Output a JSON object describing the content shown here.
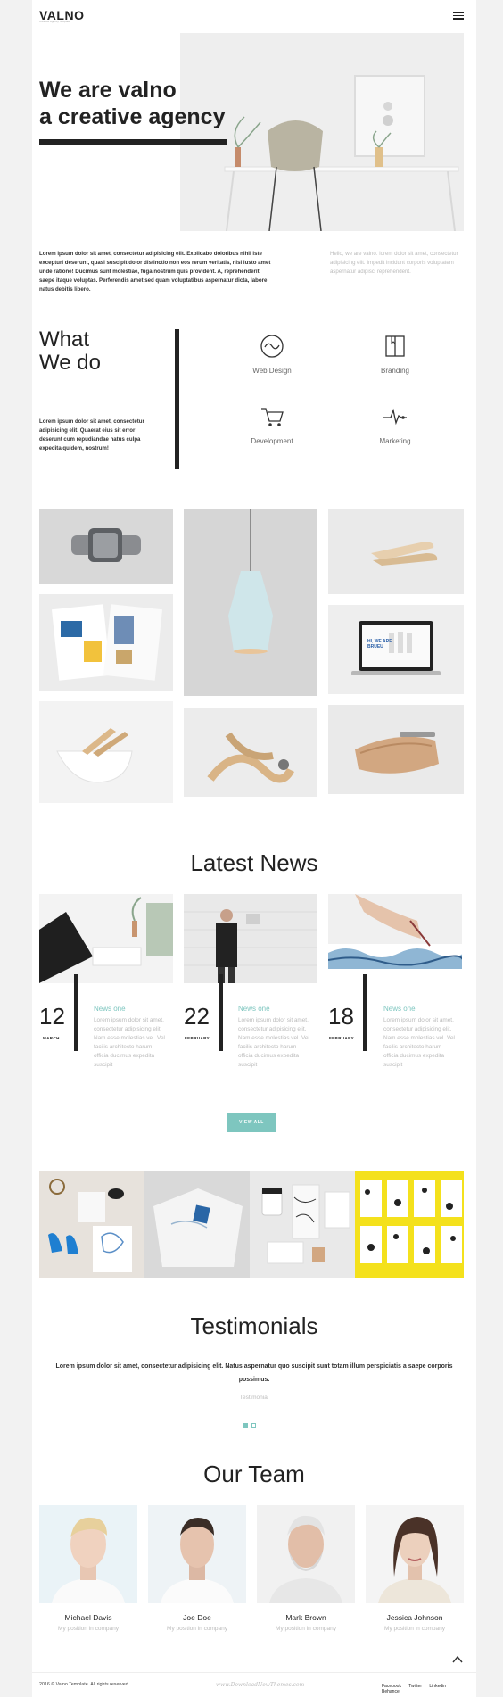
{
  "header": {
    "logo": "VALNO",
    "logo_sub": "Creative Agency Template"
  },
  "hero": {
    "title_line1": "We are valno",
    "title_line2": "a creative agency",
    "para_left": "Lorem ipsum dolor sit amet, consectetur adipisicing elit. Explicabo doloribus nihil iste excepturi deserunt, quasi suscipit dolor distinctio non eos rerum veritatis, nisi iusto amet unde ratione! Ducimus sunt molestiae, fuga nostrum quis provident. A, reprehenderit saepe itaque voluptas. Perferendis amet sed quam voluptatibus aspernatur dicta, labore natus debitis libero.",
    "para_right": "Hello, we are valno. lorem dolor sit amet, consectetur adipisicing elit. Impedit incidunt corporis voluptatem aspernatur adipisci reprehenderit."
  },
  "what_we_do": {
    "title_line1": "What",
    "title_line2": "We do",
    "para": "Lorem ipsum dolor sit amet, consectetur adipisicing elit. Quaerat eius sit error deserunt cum repudiandae natus culpa expedita quidem, nostrum!",
    "services": [
      {
        "label": "Web Design",
        "icon": "wave-circle-icon"
      },
      {
        "label": "Branding",
        "icon": "book-icon"
      },
      {
        "label": "Development",
        "icon": "cart-icon"
      },
      {
        "label": "Marketing",
        "icon": "pulse-icon"
      }
    ]
  },
  "news": {
    "title": "Latest News",
    "items": [
      {
        "day": "12",
        "month": "MARCH",
        "heading": "News one",
        "text": "Lorem ipsum dolor sit amet, consectetur adipisicing elit. Nam esse molestias vel. Vel facilis architecto harum officia ducimus expedita suscipit"
      },
      {
        "day": "22",
        "month": "FEBRUARY",
        "heading": "News one",
        "text": "Lorem ipsum dolor sit amet, consectetur adipisicing elit. Nam esse molestias vel. Vel facilis architecto harum officia ducimus expedita suscipit"
      },
      {
        "day": "18",
        "month": "FEBRUARY",
        "heading": "News one",
        "text": "Lorem ipsum dolor sit amet, consectetur adipisicing elit. Nam esse molestias vel. Vel facilis architecto harum officia ducimus expedita suscipit"
      }
    ],
    "view_all": "VIEW ALL"
  },
  "testimonials": {
    "title": "Testimonials",
    "quote": "Lorem ipsum dolor sit amet, consectetur adipisicing elit. Natus aspernatur quo suscipit sunt totam illum perspiciatis a saepe corporis possimus.",
    "name": "Testimonial"
  },
  "team": {
    "title": "Our Team",
    "members": [
      {
        "name": "Michael Davis",
        "position": "My position in company"
      },
      {
        "name": "Joe Doe",
        "position": "My position in company"
      },
      {
        "name": "Mark Brown",
        "position": "My position in company"
      },
      {
        "name": "Jessica Johnson",
        "position": "My position in company"
      }
    ]
  },
  "footer": {
    "copyright": "2016 © Valno Template. All rights reserved.",
    "watermark": "www.DownloadNewThemes.com",
    "links": [
      "Facebook",
      "Twitter",
      "Linkedin",
      "Behance"
    ]
  },
  "colors": {
    "accent": "#7ec6bf",
    "dark": "#222222",
    "muted": "#bbbbbb"
  }
}
